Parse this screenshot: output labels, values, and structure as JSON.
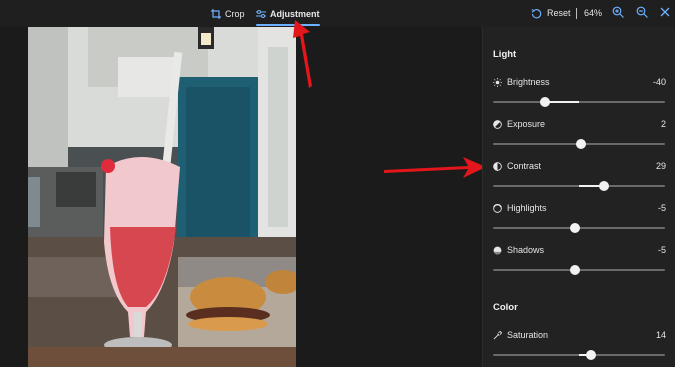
{
  "toolbar": {
    "tabs": [
      {
        "label": "Crop",
        "icon": "crop-icon"
      },
      {
        "label": "Adjustment",
        "icon": "sliders-icon",
        "active": true
      }
    ],
    "reset_label": "Reset",
    "zoom": "64%",
    "accent_color": "#6cb2ff"
  },
  "photo": {
    "description_icon": "photo-canvas"
  },
  "panel": {
    "light_title": "Light",
    "color_title": "Color",
    "light": [
      {
        "label": "Brightness",
        "icon": "sun-icon",
        "value": "-40",
        "level": -40
      },
      {
        "label": "Exposure",
        "icon": "exposure-icon",
        "value": "2",
        "level": 2
      },
      {
        "label": "Contrast",
        "icon": "contrast-icon",
        "value": "29",
        "level": 29
      },
      {
        "label": "Highlights",
        "icon": "highlights-icon",
        "value": "-5",
        "level": -5
      },
      {
        "label": "Shadows",
        "icon": "shadows-icon",
        "value": "-5",
        "level": -5
      }
    ],
    "color": [
      {
        "label": "Saturation",
        "icon": "dropper-icon",
        "value": "14",
        "level": 14
      }
    ]
  },
  "annotation_color": "#e3161b"
}
